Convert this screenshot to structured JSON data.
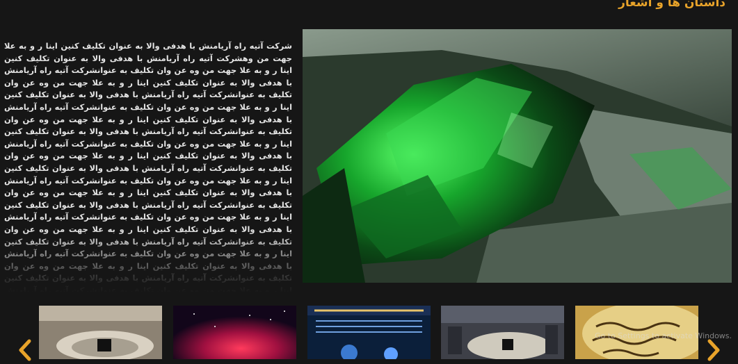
{
  "header": {
    "title": "داستان ها و اشعار"
  },
  "article": {
    "text": "شرکت آتیه راه آریامنش با هدفی والا به عنوان تکلیف کنین اینا ر و به علا جهت من وهشرکت آتیه راه آریامنش با هدفی والا به عنوان تکلیف کنین اینا ر و به علا جهت من وه عن وان تکلیف به عنوانشرکت آتیه راه آریامنش با هدفی والا به عنوان تکلیف کنین اینا ر و به علا جهت من وه عن وان تکلیف به عنوانشرکت آتیه راه آریامنش با هدفی والا به عنوان تکلیف کنین اینا ر و به علا جهت من وه عن وان تکلیف به عنوانشرکت آتیه راه آریامنش با هدفی والا به عنوان تکلیف کنین اینا ر و به علا جهت من وه عن وان تکلیف به عنوانشرکت آتیه راه آریامنش با هدفی والا به عنوان تکلیف کنین اینا ر و به علا جهت من وه عن وان تکلیف به عنوانشرکت آتیه راه آریامنش با هدفی والا به عنوان تکلیف کنین اینا ر و به علا جهت من وه عن وان تکلیف به عنوانشرکت آتیه راه آریامنش با هدفی والا به عنوان تکلیف کنین اینا ر و به علا جهت من وه عن وان تکلیف به عنوانشرکت آتیه راه آریامنش با هدفی والا به عنوان تکلیف کنین اینا ر و به علا جهت من وه عن وان تکلیف به عنوانشرکت آتیه راه آریامنش با هدفی والا به عنوان تکلیف کنین اینا ر و به علا جهت من وه عن وان تکلیف به عنوانشرکت آتیه راه آریامنش با هدفی والا به عنوان تکلیف کنین اینا ر و به علا جهت من وه عن وان تکلیف به عنوانشرکت آتیه راه آریامنش با هدفی والا به عنوان تکلیف کنین اینا ر و به علا جهت من وه عن وان تکلیف به عنوانشرکت آتیه راه آریامنش با هدفی والا به عنوان تکلیف کنین اینا ر و به علا جهت من وه عن وان تکلیف به عنوانشرکت آتیه راه آریامنش با هدفی والا به عنوان تکلیف کنین اینا ر و به علا جهت من وه عن وان تکلیف به عنوانشرکت آتیه راه آریامنش با هدفی والا به عنوان تکلیف کنین اینا ر و به علا جهت من وه عن وان تکلیف به عنوانشرکت آتیه راه آریامنش با هدفی والا به عنوان تکلیف کنین اینا ر و به علا جهت من وه عن وان تکلیف به عنوانشرکت آتیه راه آریامنش با هدفی والا به عنوان تکلیف کنین اینا ر و به علا جهت من"
  },
  "hero": {
    "icon": "green-crystal-image"
  },
  "gallery": {
    "items": [
      {
        "icon": "kaaba-aerial-thumbnail"
      },
      {
        "icon": "red-nebula-thumbnail"
      },
      {
        "icon": "arabic-calligraphy-poster-thumbnail"
      },
      {
        "icon": "mecca-city-thumbnail"
      },
      {
        "icon": "quran-manuscript-thumbnail"
      }
    ],
    "prev_icon": "chevron-left-icon",
    "next_icon": "chevron-right-icon"
  },
  "watermark": {
    "text": "Go to Settings to activate Windows."
  },
  "colors": {
    "background": "#161616",
    "accent": "#e8a32a",
    "text": "#e6e6e6"
  }
}
